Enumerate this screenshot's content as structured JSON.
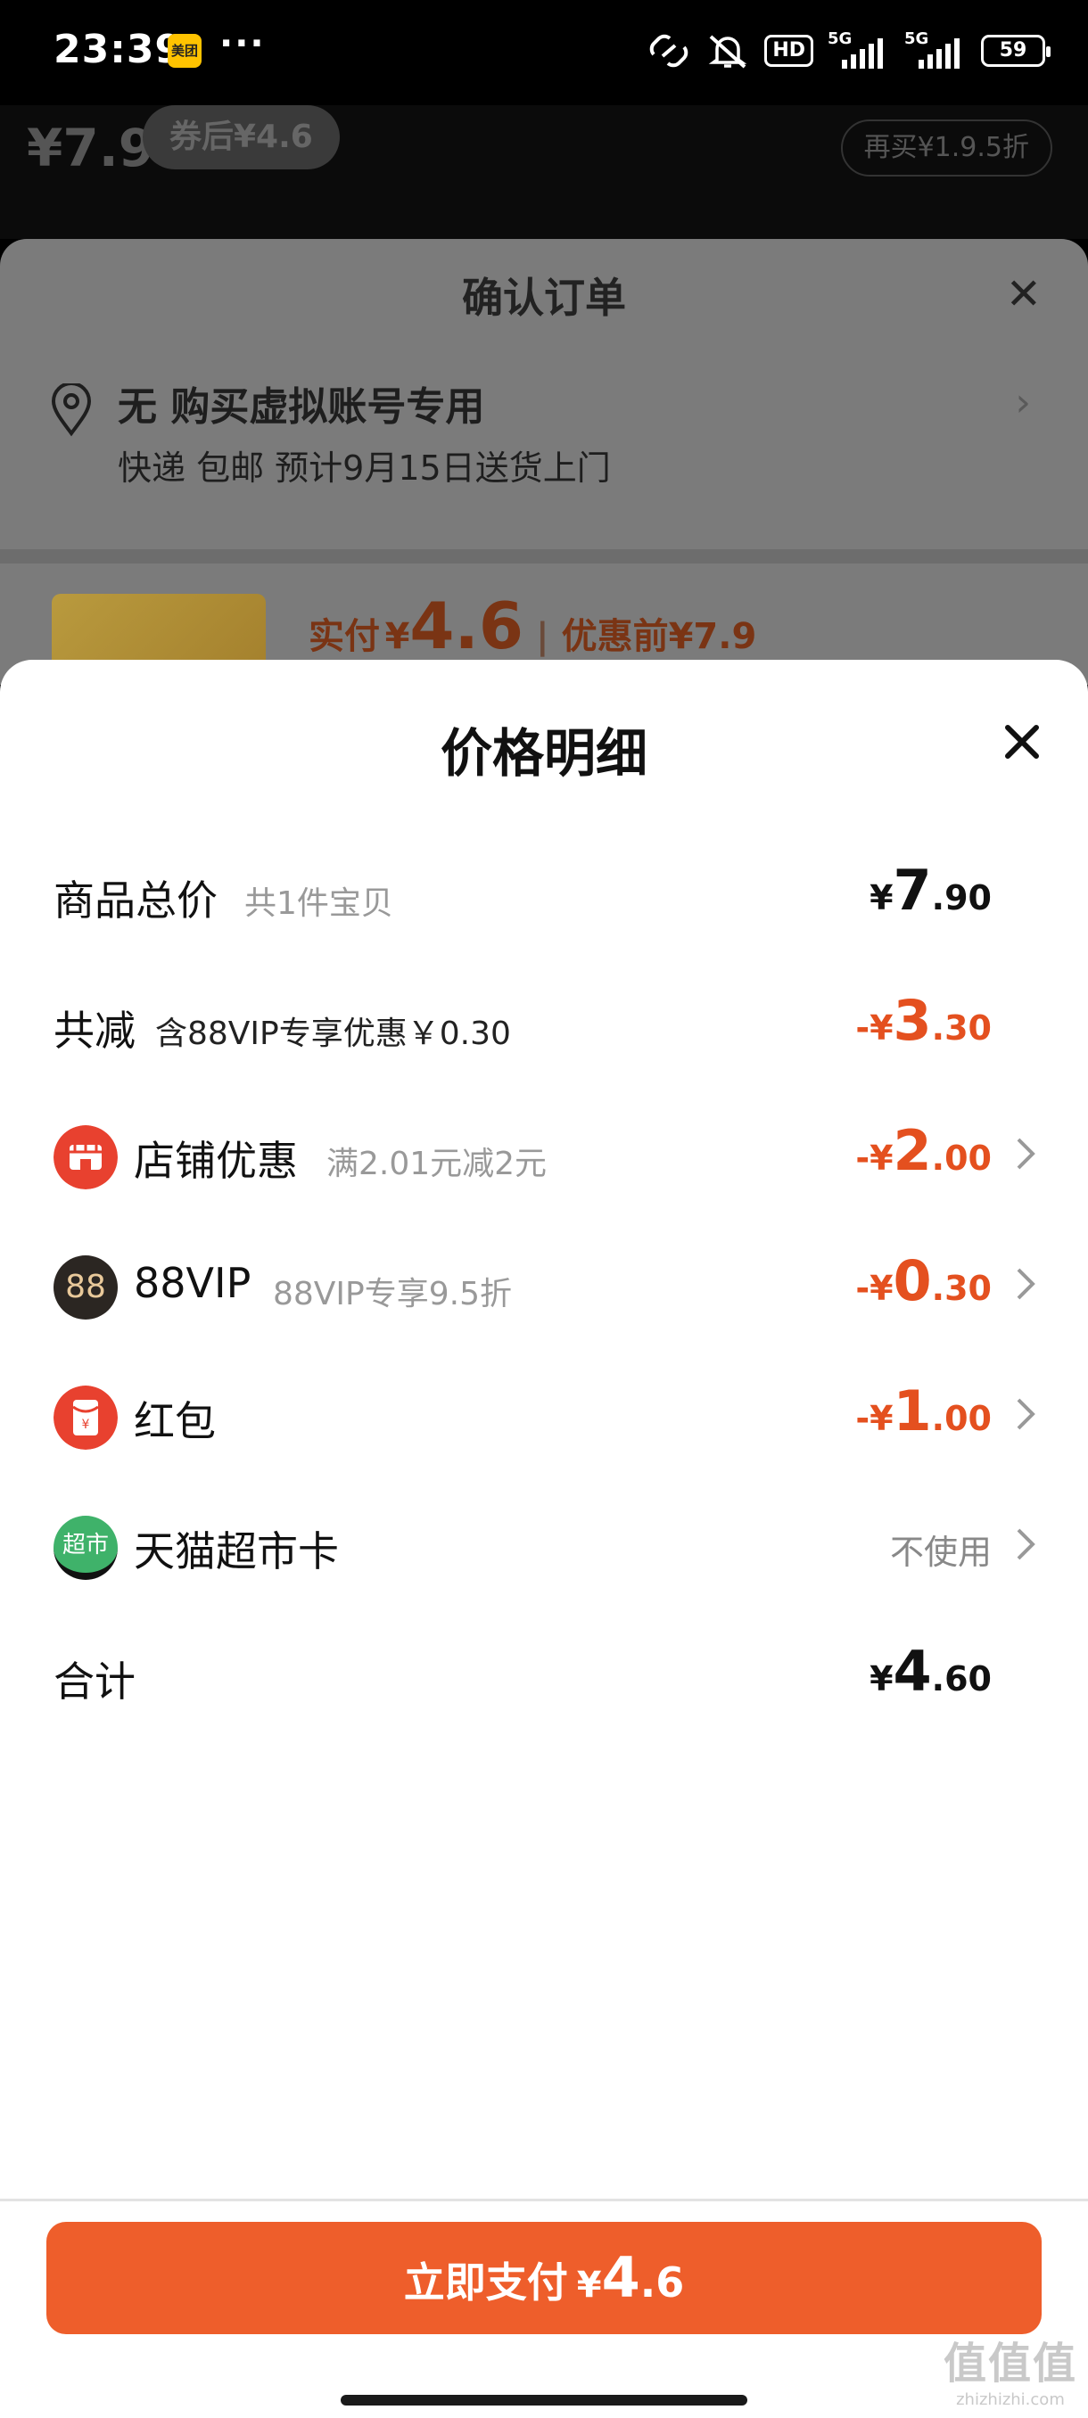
{
  "status_bar": {
    "time": "23:39",
    "app_badge": "美团",
    "more": "···",
    "hd": "HD",
    "signal1": "5G",
    "signal2": "5G",
    "battery": "59",
    "icons": [
      "link-icon",
      "mute-bell-icon",
      "hd-icon",
      "signal-icon",
      "signal-icon",
      "battery-icon"
    ]
  },
  "background": {
    "header_price": "¥7.9",
    "coupon": "券后¥4.6",
    "right_pill": "再买¥1.9.5折",
    "order_title": "确认订单",
    "address_line1": "无 购买虚拟账号专用",
    "address_line2": "快递 包邮 预计9月15日送货上门",
    "pay_label": "实付",
    "pay_currency": "¥",
    "pay_amount": "4.6",
    "before_label": "优惠前",
    "before_amount": "¥7.9"
  },
  "panel": {
    "title": "价格明细",
    "rows": {
      "total": {
        "label": "商品总价",
        "sub": "共1件宝贝",
        "currency": "¥",
        "int": "7",
        "dec": ".90"
      },
      "reduction": {
        "label": "共减",
        "sub": "含88VIP专享优惠￥0.30",
        "currency": "-¥",
        "int": "3",
        "dec": ".30"
      },
      "shop": {
        "label": "店铺优惠",
        "sub": "满2.01元减2元",
        "currency": "-¥",
        "int": "2",
        "dec": ".00"
      },
      "vip": {
        "icon_text": "88",
        "label": "88VIP",
        "sub": "88VIP专享9.5折",
        "currency": "-¥",
        "int": "0",
        "dec": ".30"
      },
      "redpacket": {
        "label": "红包",
        "currency": "-¥",
        "int": "1",
        "dec": ".00"
      },
      "tmall_card": {
        "icon_text": "超市",
        "label": "天猫超市卡",
        "value": "不使用"
      },
      "sum": {
        "label": "合计",
        "currency": "¥",
        "int": "4",
        "dec": ".60"
      }
    }
  },
  "pay_button": {
    "label": "立即支付",
    "currency": "¥",
    "int": "4",
    "dec": ".6"
  },
  "watermark": {
    "main": "值值值",
    "sub": "zhizhizhi.com"
  },
  "colors": {
    "accent": "#ee5e2b",
    "discount": "#e4501f",
    "shop_icon": "#e8412f",
    "vip_icon": "#2b2622",
    "tmall_icon": "#3fb26a"
  }
}
